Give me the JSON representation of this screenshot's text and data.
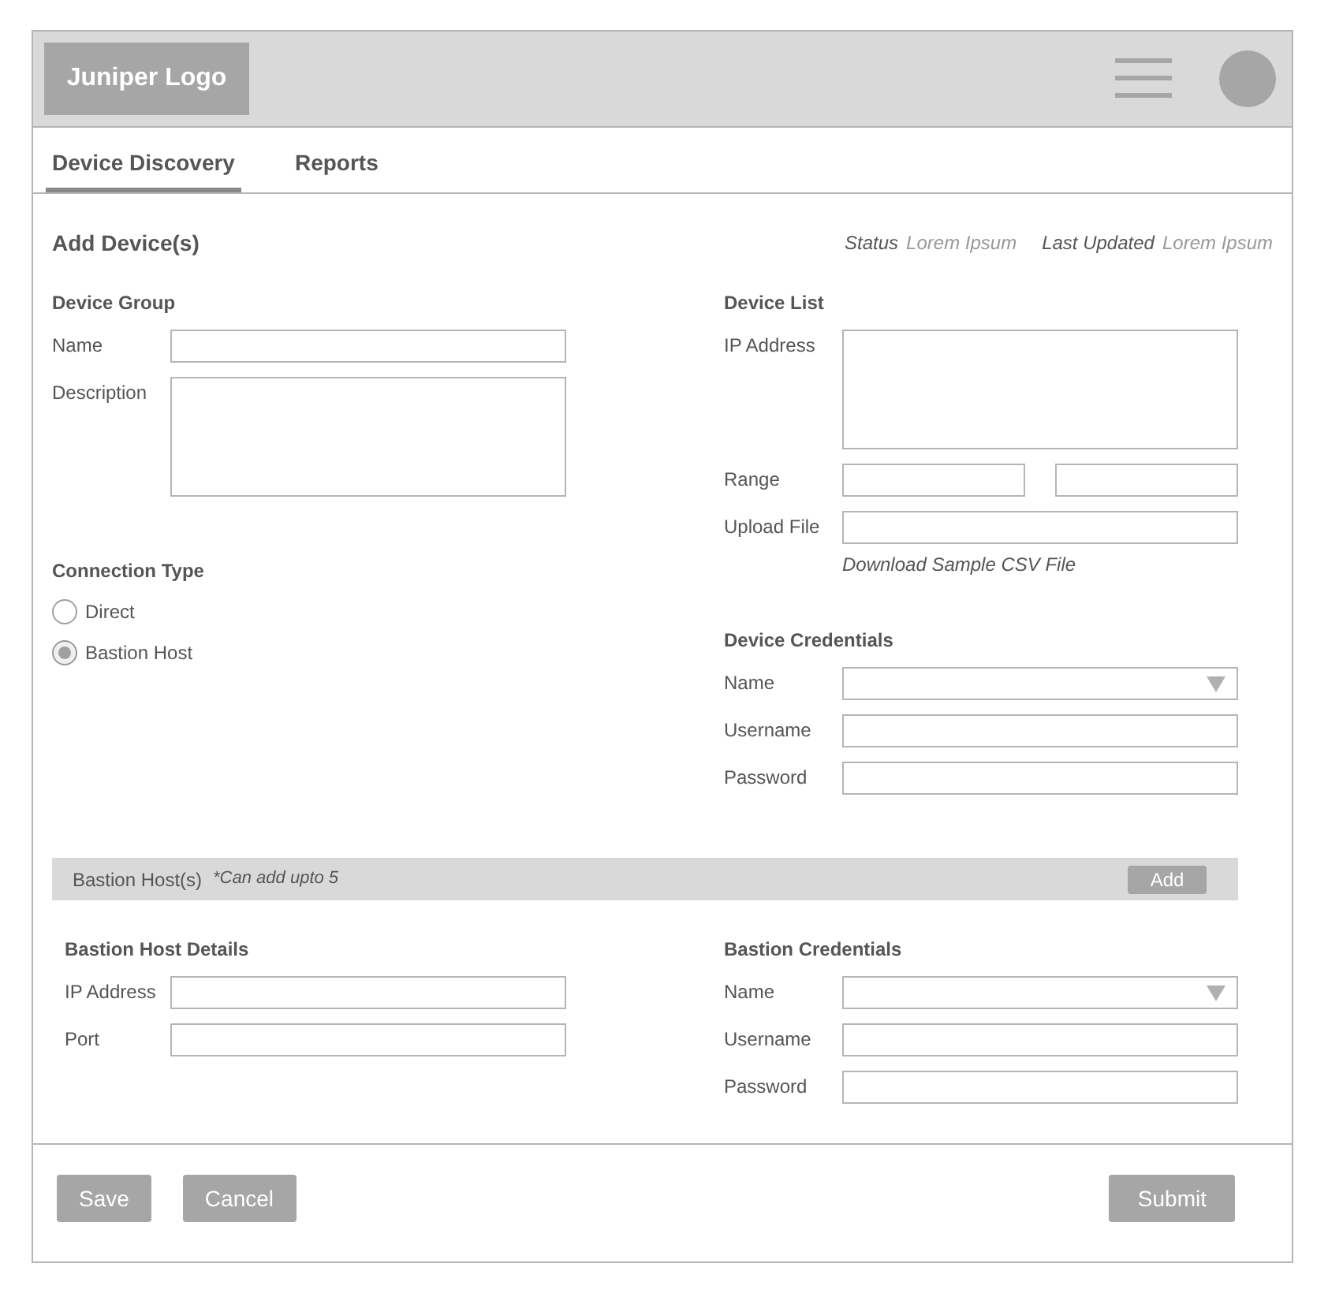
{
  "header": {
    "logo": "Juniper Logo"
  },
  "tabs": [
    {
      "label": "Device Discovery",
      "selected": true
    },
    {
      "label": "Reports",
      "selected": false
    }
  ],
  "page_title": "Add Device(s)",
  "meta": [
    {
      "label": "Status",
      "value": "Lorem Ipsum"
    },
    {
      "label": "Last Updated",
      "value": "Lorem Ipsum"
    }
  ],
  "device_group": {
    "title": "Device Group",
    "fields": [
      {
        "label": "Name",
        "kind": "text"
      },
      {
        "label": "Description",
        "kind": "textarea"
      }
    ]
  },
  "connection_type": {
    "title": "Connection Type",
    "options": [
      {
        "label": "Direct",
        "selected": false
      },
      {
        "label": "Bastion Host",
        "selected": true
      }
    ]
  },
  "device_list": {
    "title": "Device List",
    "fields": [
      {
        "label": "IP Address",
        "kind": "textarea"
      },
      {
        "label": "Range",
        "kind": "range"
      },
      {
        "label": "Upload File",
        "kind": "text"
      }
    ],
    "link": "Download Sample CSV File"
  },
  "device_credentials": {
    "title": "Device Credentials",
    "fields": [
      {
        "label": "Name",
        "kind": "select"
      },
      {
        "label": "Username",
        "kind": "text"
      },
      {
        "label": "Password",
        "kind": "text"
      }
    ]
  },
  "bastion_bar": {
    "title": "Bastion Host(s)",
    "note": "*Can add upto 5",
    "button": "Add"
  },
  "bastion_details": {
    "title": "Bastion Host Details",
    "fields": [
      {
        "label": "IP Address",
        "kind": "text"
      },
      {
        "label": "Port",
        "kind": "text"
      }
    ]
  },
  "bastion_credentials": {
    "title": "Bastion Credentials",
    "fields": [
      {
        "label": "Name",
        "kind": "select"
      },
      {
        "label": "Username",
        "kind": "text"
      },
      {
        "label": "Password",
        "kind": "text"
      }
    ]
  },
  "footer": {
    "left_buttons": [
      "Save",
      "Cancel"
    ],
    "right_buttons": [
      "Submit"
    ]
  }
}
